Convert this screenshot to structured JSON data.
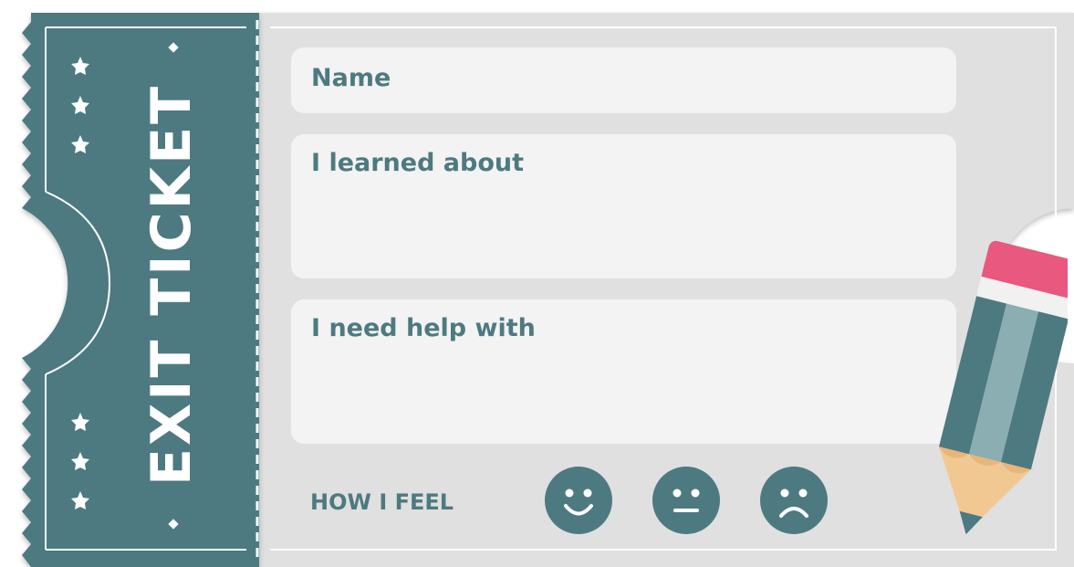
{
  "ticket": {
    "title": "EXIT TICKET",
    "fields": {
      "name": "Name",
      "learned": "I learned about",
      "help": "I need help with"
    },
    "feel_label": "HOW I FEEL",
    "faces": [
      {
        "name": "happy-face-icon"
      },
      {
        "name": "neutral-face-icon"
      },
      {
        "name": "sad-face-icon"
      }
    ]
  },
  "colors": {
    "accent": "#4d7a80",
    "panel": "#e0e0e0",
    "field": "#f3f3f3",
    "eraser": "#e9587f",
    "pencil_wood": "#f2c892"
  }
}
